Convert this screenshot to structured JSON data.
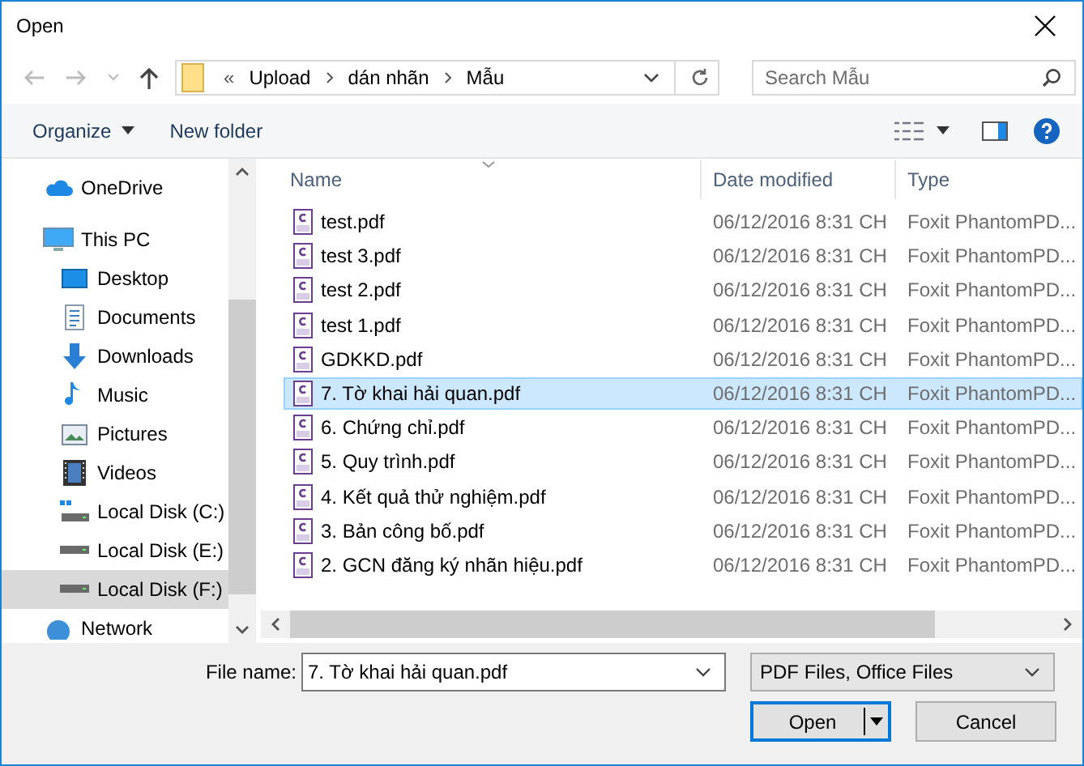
{
  "window": {
    "title": "Open"
  },
  "address_bar": {
    "overflow": "«",
    "path": [
      "Upload",
      "dán nhãn",
      "Mẫu"
    ]
  },
  "search": {
    "placeholder": "Search Mẫu"
  },
  "toolbar": {
    "organize": "Organize",
    "new_folder": "New folder"
  },
  "sidebar": {
    "items": [
      {
        "label": "OneDrive",
        "kind": "cloud",
        "selected": false
      },
      {
        "label": "This PC",
        "kind": "pc",
        "selected": false,
        "children": [
          {
            "label": "Desktop",
            "kind": "desktop",
            "selected": false
          },
          {
            "label": "Documents",
            "kind": "documents",
            "selected": false
          },
          {
            "label": "Downloads",
            "kind": "downloads",
            "selected": false
          },
          {
            "label": "Music",
            "kind": "music",
            "selected": false
          },
          {
            "label": "Pictures",
            "kind": "pictures",
            "selected": false
          },
          {
            "label": "Videos",
            "kind": "videos",
            "selected": false
          },
          {
            "label": "Local Disk (C:)",
            "kind": "system-disk",
            "selected": false
          },
          {
            "label": "Local Disk (E:)",
            "kind": "disk",
            "selected": false
          },
          {
            "label": "Local Disk (F:)",
            "kind": "disk",
            "selected": true
          }
        ]
      },
      {
        "label": "Network",
        "kind": "network",
        "selected": false
      }
    ]
  },
  "table": {
    "columns": [
      {
        "label": "Name",
        "sorted": true
      },
      {
        "label": "Date modified",
        "sorted": false
      },
      {
        "label": "Type",
        "sorted": false
      }
    ],
    "rows": [
      {
        "name": "test.pdf",
        "date": "06/12/2016 8:31 CH",
        "type": "Foxit PhantomPD...",
        "selected": false
      },
      {
        "name": "test 3.pdf",
        "date": "06/12/2016 8:31 CH",
        "type": "Foxit PhantomPD...",
        "selected": false
      },
      {
        "name": "test 2.pdf",
        "date": "06/12/2016 8:31 CH",
        "type": "Foxit PhantomPD...",
        "selected": false
      },
      {
        "name": "test 1.pdf",
        "date": "06/12/2016 8:31 CH",
        "type": "Foxit PhantomPD...",
        "selected": false
      },
      {
        "name": "GDKKD.pdf",
        "date": "06/12/2016 8:31 CH",
        "type": "Foxit PhantomPD...",
        "selected": false
      },
      {
        "name": "7. Tờ khai hải quan.pdf",
        "date": "06/12/2016 8:31 CH",
        "type": "Foxit PhantomPD...",
        "selected": true
      },
      {
        "name": "6. Chứng chỉ.pdf",
        "date": "06/12/2016 8:31 CH",
        "type": "Foxit PhantomPD...",
        "selected": false
      },
      {
        "name": "5. Quy trình.pdf",
        "date": "06/12/2016 8:31 CH",
        "type": "Foxit PhantomPD...",
        "selected": false
      },
      {
        "name": "4. Kết quả thử nghiệm.pdf",
        "date": "06/12/2016 8:31 CH",
        "type": "Foxit PhantomPD...",
        "selected": false
      },
      {
        "name": "3. Bản công bố.pdf",
        "date": "06/12/2016 8:31 CH",
        "type": "Foxit PhantomPD...",
        "selected": false
      },
      {
        "name": "2. GCN đăng ký nhãn hiệu.pdf",
        "date": "06/12/2016 8:31 CH",
        "type": "Foxit PhantomPD...",
        "selected": false
      }
    ]
  },
  "file_name": {
    "label": "File name:",
    "value": "7. Tờ khai hải quan.pdf"
  },
  "file_type": {
    "value": "PDF Files, Office Files"
  },
  "buttons": {
    "open": "Open",
    "cancel": "Cancel"
  }
}
